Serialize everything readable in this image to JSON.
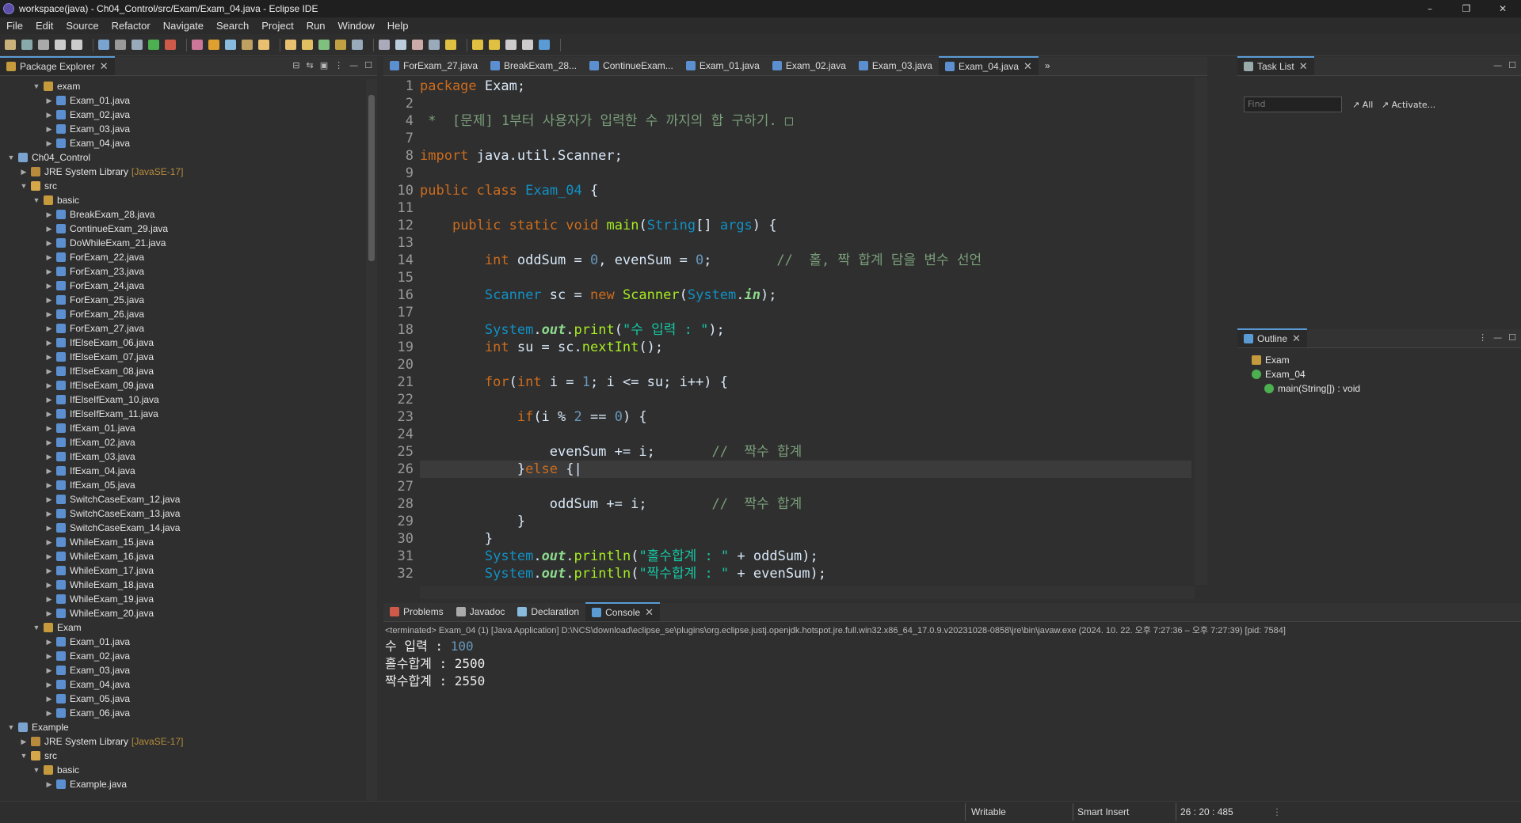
{
  "window": {
    "title": "workspace(java) - Ch04_Control/src/Exam/Exam_04.java - Eclipse IDE",
    "min": "–",
    "max": "❐",
    "close": "✕"
  },
  "menu": [
    "File",
    "Edit",
    "Source",
    "Refactor",
    "Navigate",
    "Search",
    "Project",
    "Run",
    "Window",
    "Help"
  ],
  "package_explorer": {
    "tab_label": "Package Explorer",
    "rows": [
      {
        "depth": 2,
        "twisty": "v",
        "icon": "package",
        "label": "exam"
      },
      {
        "depth": 3,
        "twisty": ">",
        "icon": "java",
        "label": "Exam_01.java"
      },
      {
        "depth": 3,
        "twisty": ">",
        "icon": "java",
        "label": "Exam_02.java"
      },
      {
        "depth": 3,
        "twisty": ">",
        "icon": "java",
        "label": "Exam_03.java"
      },
      {
        "depth": 3,
        "twisty": ">",
        "icon": "java",
        "label": "Exam_04.java"
      },
      {
        "depth": 0,
        "twisty": "v",
        "icon": "project",
        "label": "Ch04_Control"
      },
      {
        "depth": 1,
        "twisty": ">",
        "icon": "library",
        "label": "JRE System Library",
        "extra": "[JavaSE-17]"
      },
      {
        "depth": 1,
        "twisty": "v",
        "icon": "folder",
        "label": "src"
      },
      {
        "depth": 2,
        "twisty": "v",
        "icon": "package",
        "label": "basic"
      },
      {
        "depth": 3,
        "twisty": ">",
        "icon": "java",
        "label": "BreakExam_28.java"
      },
      {
        "depth": 3,
        "twisty": ">",
        "icon": "java",
        "label": "ContinueExam_29.java"
      },
      {
        "depth": 3,
        "twisty": ">",
        "icon": "java",
        "label": "DoWhileExam_21.java"
      },
      {
        "depth": 3,
        "twisty": ">",
        "icon": "java",
        "label": "ForExam_22.java"
      },
      {
        "depth": 3,
        "twisty": ">",
        "icon": "java",
        "label": "ForExam_23.java"
      },
      {
        "depth": 3,
        "twisty": ">",
        "icon": "java",
        "label": "ForExam_24.java"
      },
      {
        "depth": 3,
        "twisty": ">",
        "icon": "java",
        "label": "ForExam_25.java"
      },
      {
        "depth": 3,
        "twisty": ">",
        "icon": "java",
        "label": "ForExam_26.java"
      },
      {
        "depth": 3,
        "twisty": ">",
        "icon": "java",
        "label": "ForExam_27.java"
      },
      {
        "depth": 3,
        "twisty": ">",
        "icon": "java",
        "label": "IfElseExam_06.java"
      },
      {
        "depth": 3,
        "twisty": ">",
        "icon": "java",
        "label": "IfElseExam_07.java"
      },
      {
        "depth": 3,
        "twisty": ">",
        "icon": "java",
        "label": "IfElseExam_08.java"
      },
      {
        "depth": 3,
        "twisty": ">",
        "icon": "java",
        "label": "IfElseExam_09.java"
      },
      {
        "depth": 3,
        "twisty": ">",
        "icon": "java",
        "label": "IfElseIfExam_10.java"
      },
      {
        "depth": 3,
        "twisty": ">",
        "icon": "java",
        "label": "IfElseIfExam_11.java"
      },
      {
        "depth": 3,
        "twisty": ">",
        "icon": "java",
        "label": "IfExam_01.java"
      },
      {
        "depth": 3,
        "twisty": ">",
        "icon": "java",
        "label": "IfExam_02.java"
      },
      {
        "depth": 3,
        "twisty": ">",
        "icon": "java",
        "label": "IfExam_03.java"
      },
      {
        "depth": 3,
        "twisty": ">",
        "icon": "java",
        "label": "IfExam_04.java"
      },
      {
        "depth": 3,
        "twisty": ">",
        "icon": "java",
        "label": "IfExam_05.java"
      },
      {
        "depth": 3,
        "twisty": ">",
        "icon": "java",
        "label": "SwitchCaseExam_12.java"
      },
      {
        "depth": 3,
        "twisty": ">",
        "icon": "java",
        "label": "SwitchCaseExam_13.java"
      },
      {
        "depth": 3,
        "twisty": ">",
        "icon": "java",
        "label": "SwitchCaseExam_14.java"
      },
      {
        "depth": 3,
        "twisty": ">",
        "icon": "java",
        "label": "WhileExam_15.java"
      },
      {
        "depth": 3,
        "twisty": ">",
        "icon": "java",
        "label": "WhileExam_16.java"
      },
      {
        "depth": 3,
        "twisty": ">",
        "icon": "java",
        "label": "WhileExam_17.java"
      },
      {
        "depth": 3,
        "twisty": ">",
        "icon": "java",
        "label": "WhileExam_18.java"
      },
      {
        "depth": 3,
        "twisty": ">",
        "icon": "java",
        "label": "WhileExam_19.java"
      },
      {
        "depth": 3,
        "twisty": ">",
        "icon": "java",
        "label": "WhileExam_20.java"
      },
      {
        "depth": 2,
        "twisty": "v",
        "icon": "package",
        "label": "Exam"
      },
      {
        "depth": 3,
        "twisty": ">",
        "icon": "java",
        "label": "Exam_01.java"
      },
      {
        "depth": 3,
        "twisty": ">",
        "icon": "java",
        "label": "Exam_02.java"
      },
      {
        "depth": 3,
        "twisty": ">",
        "icon": "java",
        "label": "Exam_03.java"
      },
      {
        "depth": 3,
        "twisty": ">",
        "icon": "java",
        "label": "Exam_04.java"
      },
      {
        "depth": 3,
        "twisty": ">",
        "icon": "java",
        "label": "Exam_05.java"
      },
      {
        "depth": 3,
        "twisty": ">",
        "icon": "java",
        "label": "Exam_06.java"
      },
      {
        "depth": 0,
        "twisty": "v",
        "icon": "project",
        "label": "Example"
      },
      {
        "depth": 1,
        "twisty": ">",
        "icon": "library",
        "label": "JRE System Library",
        "extra": "[JavaSE-17]"
      },
      {
        "depth": 1,
        "twisty": "v",
        "icon": "folder",
        "label": "src"
      },
      {
        "depth": 2,
        "twisty": "v",
        "icon": "package",
        "label": "basic"
      },
      {
        "depth": 3,
        "twisty": ">",
        "icon": "java",
        "label": "Example.java"
      }
    ]
  },
  "editor": {
    "tabs": [
      {
        "label": "ForExam_27.java",
        "active": false
      },
      {
        "label": "BreakExam_28...",
        "active": false
      },
      {
        "label": "ContinueExam...",
        "active": false
      },
      {
        "label": "Exam_01.java",
        "active": false
      },
      {
        "label": "Exam_02.java",
        "active": false
      },
      {
        "label": "Exam_03.java",
        "active": false
      },
      {
        "label": "Exam_04.java",
        "active": true
      }
    ],
    "overflow": "»",
    "line_numbers": [
      "1",
      "2",
      "4",
      "7",
      "8",
      "9",
      "10",
      "11",
      "12",
      "13",
      "14",
      "15",
      "16",
      "17",
      "18",
      "19",
      "20",
      "21",
      "22",
      "23",
      "24",
      "25",
      "26",
      "27",
      "28",
      "29",
      "30",
      "31",
      "32"
    ],
    "lines": [
      [
        [
          "kw",
          "package"
        ],
        [
          "t",
          " Exam;"
        ]
      ],
      [],
      [
        [
          "cm",
          " *  [문제] 1부터 사용자가 입력한 수 까지의 합 구하기. □"
        ]
      ],
      [],
      [
        [
          "kw",
          "import"
        ],
        [
          "t",
          " java.util.Scanner;"
        ]
      ],
      [],
      [
        [
          "kw",
          "public"
        ],
        [
          "t",
          " "
        ],
        [
          "kw",
          "class"
        ],
        [
          "t",
          " "
        ],
        [
          "cls",
          "Exam_04"
        ],
        [
          "t",
          " {"
        ]
      ],
      [],
      [
        [
          "t",
          "    "
        ],
        [
          "kw",
          "public"
        ],
        [
          "t",
          " "
        ],
        [
          "kw",
          "static"
        ],
        [
          "t",
          " "
        ],
        [
          "kw",
          "void"
        ],
        [
          "t",
          " "
        ],
        [
          "fn",
          "main"
        ],
        [
          "t",
          "("
        ],
        [
          "ty",
          "String"
        ],
        [
          "t",
          "[] "
        ],
        [
          "ty",
          "args"
        ],
        [
          "t",
          ") {"
        ]
      ],
      [],
      [
        [
          "t",
          "        "
        ],
        [
          "kw",
          "int"
        ],
        [
          "t",
          " oddSum = "
        ],
        [
          "num",
          "0"
        ],
        [
          "t",
          ", evenSum = "
        ],
        [
          "num",
          "0"
        ],
        [
          "t",
          ";        "
        ],
        [
          "cm",
          "//  홀, 짝 합계 담을 변수 선언"
        ]
      ],
      [],
      [
        [
          "t",
          "        "
        ],
        [
          "ty",
          "Scanner"
        ],
        [
          "t",
          " sc = "
        ],
        [
          "kw",
          "new"
        ],
        [
          "t",
          " "
        ],
        [
          "fn",
          "Scanner"
        ],
        [
          "t",
          "("
        ],
        [
          "ty",
          "System"
        ],
        [
          "t",
          "."
        ],
        [
          "fld",
          "in"
        ],
        [
          "t",
          ");"
        ]
      ],
      [],
      [
        [
          "t",
          "        "
        ],
        [
          "ty",
          "System"
        ],
        [
          "t",
          "."
        ],
        [
          "fld",
          "out"
        ],
        [
          "t",
          "."
        ],
        [
          "fn",
          "print"
        ],
        [
          "t",
          "("
        ],
        [
          "str",
          "\"수 입력 : \""
        ],
        [
          "t",
          ");"
        ]
      ],
      [
        [
          "t",
          "        "
        ],
        [
          "kw",
          "int"
        ],
        [
          "t",
          " su = sc."
        ],
        [
          "fn",
          "nextInt"
        ],
        [
          "t",
          "();"
        ]
      ],
      [],
      [
        [
          "t",
          "        "
        ],
        [
          "kw",
          "for"
        ],
        [
          "t",
          "("
        ],
        [
          "kw",
          "int"
        ],
        [
          "t",
          " i = "
        ],
        [
          "num",
          "1"
        ],
        [
          "t",
          "; i <= su; i++) {"
        ]
      ],
      [],
      [
        [
          "t",
          "            "
        ],
        [
          "kw",
          "if"
        ],
        [
          "t",
          "(i % "
        ],
        [
          "num",
          "2"
        ],
        [
          "t",
          " == "
        ],
        [
          "num",
          "0"
        ],
        [
          "t",
          ") {"
        ]
      ],
      [],
      [
        [
          "t",
          "                evenSum += i;       "
        ],
        [
          "cm",
          "//  짝수 합계"
        ]
      ],
      [
        [
          "t",
          "            }"
        ],
        [
          "kw",
          "else"
        ],
        [
          "t",
          " {|"
        ]
      ],
      [],
      [
        [
          "t",
          "                oddSum += i;        "
        ],
        [
          "cm",
          "//  짝수 합계"
        ]
      ],
      [
        [
          "t",
          "            }"
        ]
      ],
      [
        [
          "t",
          "        }"
        ]
      ],
      [
        [
          "t",
          "        "
        ],
        [
          "ty",
          "System"
        ],
        [
          "t",
          "."
        ],
        [
          "fld",
          "out"
        ],
        [
          "t",
          "."
        ],
        [
          "fn",
          "println"
        ],
        [
          "t",
          "("
        ],
        [
          "str",
          "\"홀수합계 : \""
        ],
        [
          "t",
          " + oddSum);"
        ]
      ],
      [
        [
          "t",
          "        "
        ],
        [
          "ty",
          "System"
        ],
        [
          "t",
          "."
        ],
        [
          "fld",
          "out"
        ],
        [
          "t",
          "."
        ],
        [
          "fn",
          "println"
        ],
        [
          "t",
          "("
        ],
        [
          "str",
          "\"짝수합계 : \""
        ],
        [
          "t",
          " + evenSum);"
        ]
      ]
    ],
    "current_line_index": 22
  },
  "task_list": {
    "tab_label": "Task List",
    "find_placeholder": "Find",
    "all_label": "All",
    "activate_label": "Activate..."
  },
  "outline": {
    "tab_label": "Outline",
    "items": [
      {
        "label": "Exam",
        "indent": 0
      },
      {
        "label": "Exam_04",
        "indent": 0
      },
      {
        "label": "main(String[]) : void",
        "indent": 1
      }
    ]
  },
  "bottom": {
    "tabs": [
      {
        "label": "Problems",
        "active": false
      },
      {
        "label": "Javadoc",
        "active": false
      },
      {
        "label": "Declaration",
        "active": false
      },
      {
        "label": "Console",
        "active": true
      }
    ],
    "console_header": "<terminated> Exam_04 (1) [Java Application] D:\\NCS\\download\\eclipse_se\\plugins\\org.eclipse.justj.openjdk.hotspot.jre.full.win32.x86_64_17.0.9.v20231028-0858\\jre\\bin\\javaw.exe  (2024. 10. 22. 오후 7:27:36 – 오후 7:27:39) [pid: 7584]",
    "console_lines": [
      {
        "prefix": "수 입력 : ",
        "input": "100"
      },
      {
        "prefix": "홀수합계 : 2500",
        "input": ""
      },
      {
        "prefix": "짝수합계 : 2550",
        "input": ""
      }
    ]
  },
  "status": {
    "writable": "Writable",
    "insert_mode": "Smart Insert",
    "position": "26 : 20 : 485"
  }
}
